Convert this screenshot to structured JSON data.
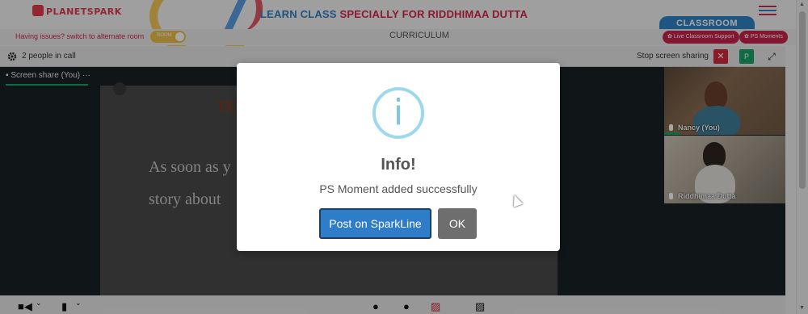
{
  "header": {
    "logo": "PLANETSPARK",
    "class_title_prefix": "LEARN CLASS ",
    "class_title_highlight": "SPECIALLY FOR RIDDHIMAA DUTTA",
    "classroom_tab": "CLASSROOM"
  },
  "subbar": {
    "issues_text": "Having issues? switch to alternate room",
    "toggle_label": "ROOM",
    "curriculum": "CURRICULUM",
    "live_support": "Live Classroom Support",
    "ps_moments": "PS Moments"
  },
  "callbar": {
    "people_count": "2 people in call",
    "stop_sharing": "Stop screen sharing",
    "p_button": "P"
  },
  "stage": {
    "share_tab": "Screen share (You)",
    "share_menu": "···",
    "doc_heading": "TE",
    "doc_line1": "As soon as y",
    "doc_line2": "story about"
  },
  "participants": [
    {
      "name": "Nancy (You)"
    },
    {
      "name": "Riddhimaa Dutta"
    }
  ],
  "modal": {
    "icon": "i",
    "title": "Info!",
    "message": "PS Moment added successfully",
    "primary_button": "Post on SparkLine",
    "secondary_button": "OK"
  },
  "colors": {
    "brand_red": "#d8264a",
    "brand_blue": "#2f85c7",
    "green": "#1aa56a",
    "info_icon": "#9dd8ec"
  }
}
